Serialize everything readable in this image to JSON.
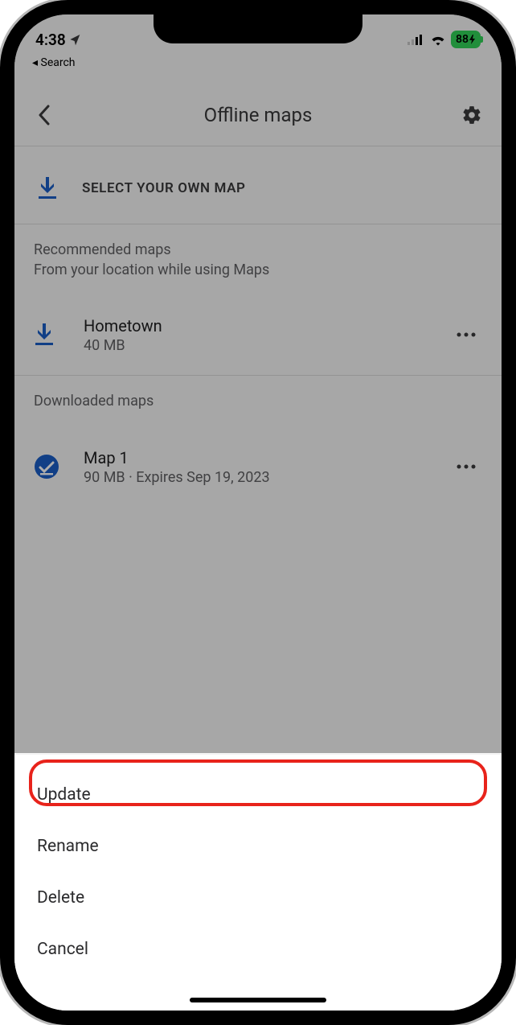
{
  "status_bar": {
    "time": "4:38",
    "back_app": "◂ Search",
    "battery": "88"
  },
  "header": {
    "title": "Offline maps"
  },
  "select_row": {
    "label": "SELECT YOUR OWN MAP"
  },
  "recommended": {
    "title": "Recommended maps",
    "subtitle": "From your location while using Maps",
    "items": [
      {
        "name": "Hometown",
        "detail": "40 MB"
      }
    ]
  },
  "downloaded": {
    "title": "Downloaded maps",
    "items": [
      {
        "name": "Map 1",
        "detail": "90 MB  ·  Expires Sep 19, 2023"
      }
    ]
  },
  "sheet": {
    "items": [
      "Update",
      "Rename",
      "Delete",
      "Cancel"
    ],
    "highlighted_index": 0
  }
}
